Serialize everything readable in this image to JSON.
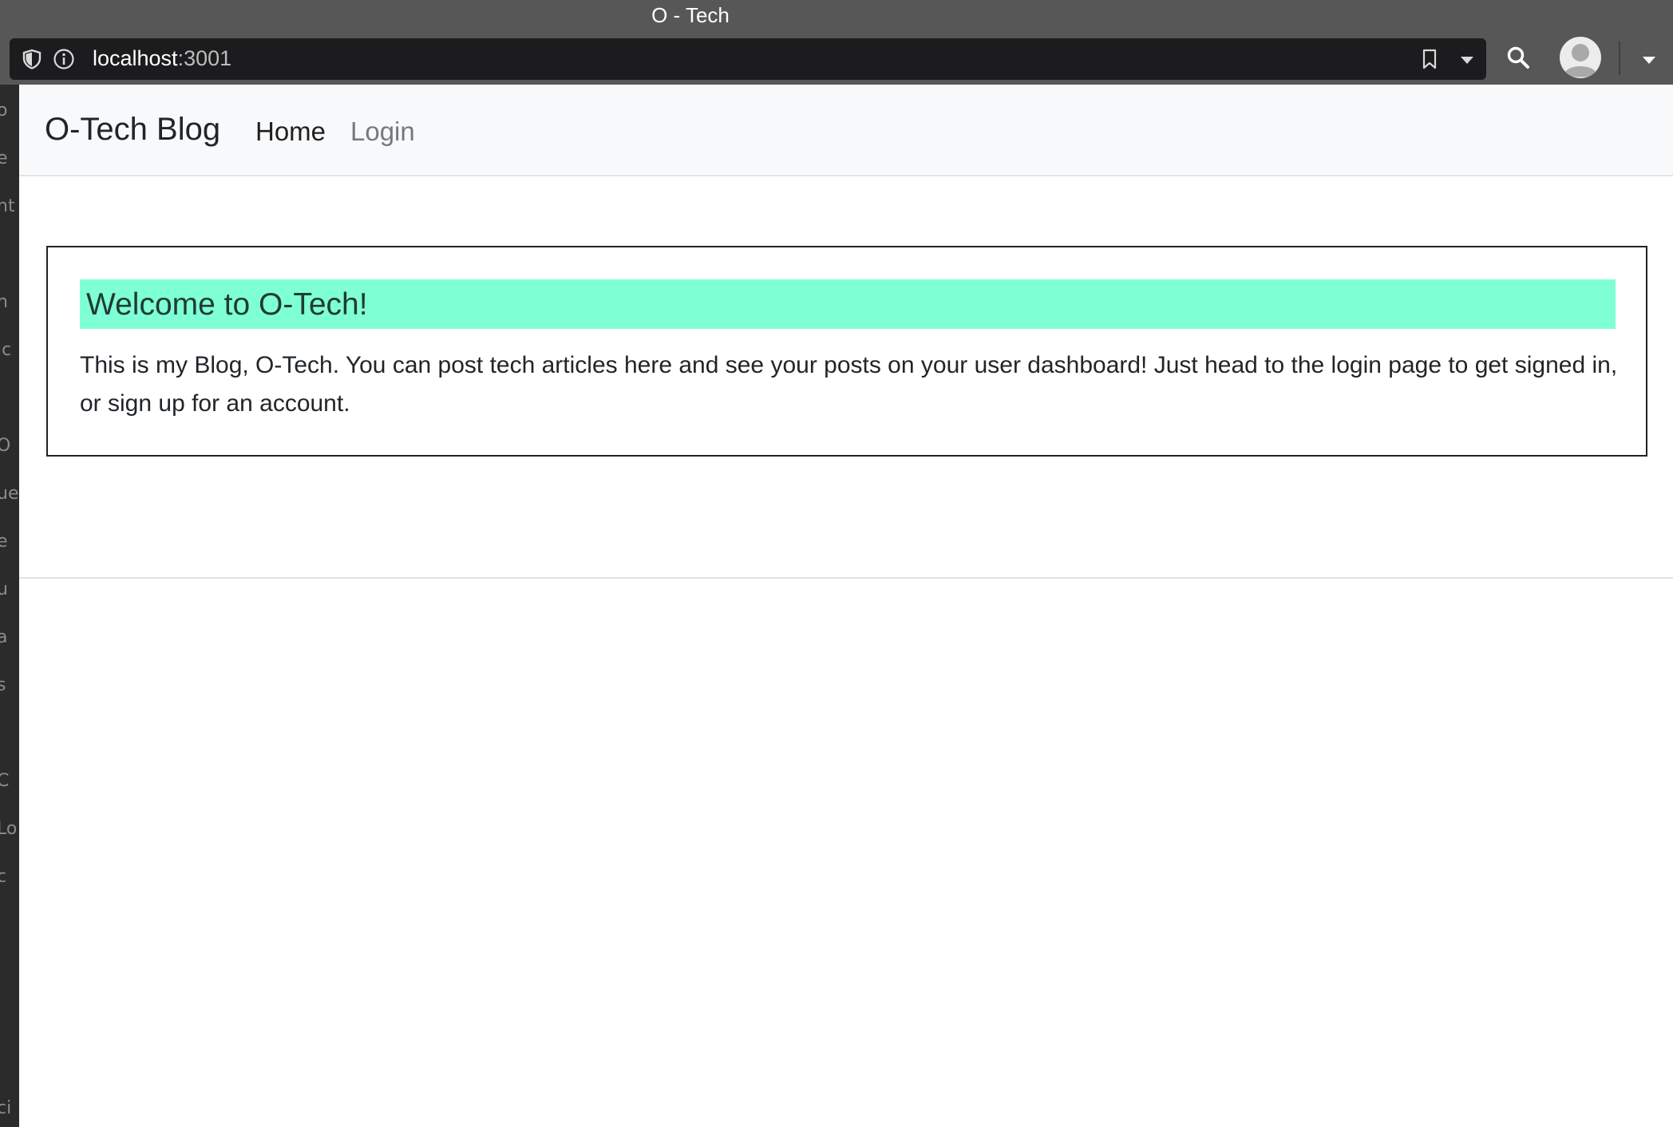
{
  "browser": {
    "window_title": "O - Tech",
    "url_host": "localhost",
    "url_port": ":3001"
  },
  "side_strip": {
    "fragments": [
      "o",
      "e",
      "nt",
      "n",
      "ic",
      "O",
      "ue",
      "e",
      "u",
      "a",
      "s",
      "C",
      "Lo",
      "c",
      "ci"
    ]
  },
  "navbar": {
    "brand": "O-Tech Blog",
    "links": [
      {
        "label": "Home",
        "active": true
      },
      {
        "label": "Login",
        "active": false
      }
    ]
  },
  "main": {
    "heading": "Welcome to O-Tech!",
    "text": "This is my Blog, O-Tech. You can post tech articles here and see your posts on your user dashboard! Just head to the login page to get signed in, or sign up for an account."
  },
  "colors": {
    "heading_bg": "#7fffd4",
    "navbar_bg": "#f8f9fa"
  }
}
